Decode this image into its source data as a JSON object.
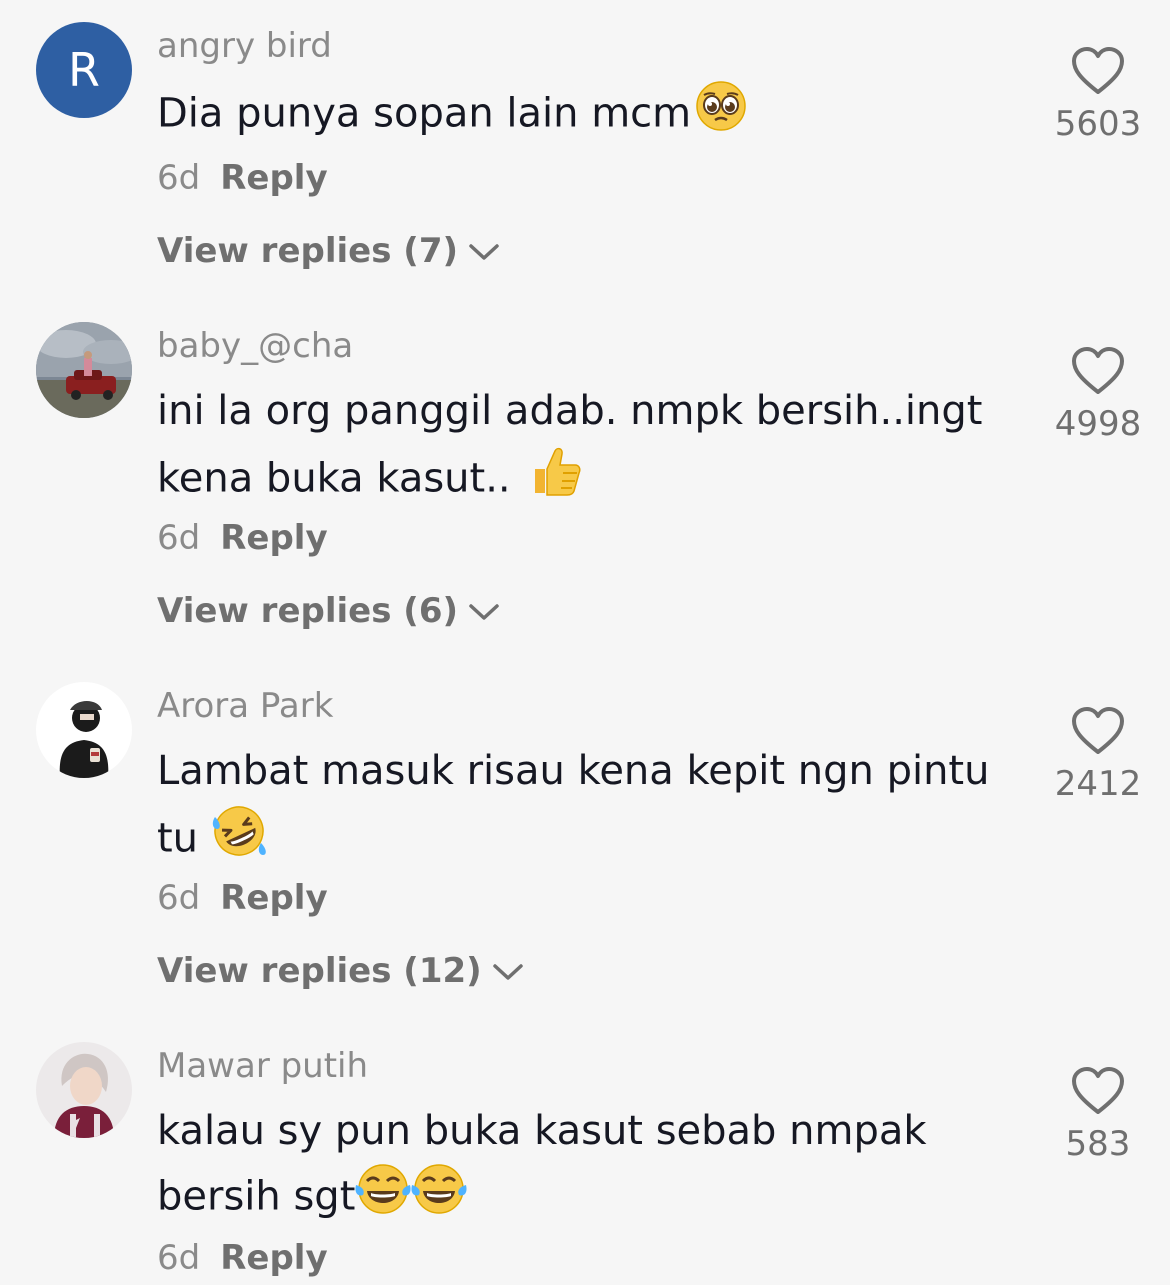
{
  "comments": [
    {
      "avatar_letter": "R",
      "username": "angry bird",
      "text": "Dia punya sopan lain mcm",
      "emoji": "pleading-face",
      "time": "6d",
      "reply_label": "Reply",
      "view_replies": "View replies (7)",
      "likes": "5603"
    },
    {
      "username": "baby_@cha",
      "text": "ini la org panggil adab. nmpk bersih..ingt kena buka kasut..",
      "emoji": "thumbs-up",
      "time": "6d",
      "reply_label": "Reply",
      "view_replies": "View replies (6)",
      "likes": "4998"
    },
    {
      "username": "Arora Park",
      "text": "Lambat masuk risau kena kepit ngn pintu tu",
      "emoji": "rolling-on-floor-laughing",
      "time": "6d",
      "reply_label": "Reply",
      "view_replies": "View replies (12)",
      "likes": "2412"
    },
    {
      "username": "Mawar putih",
      "text": "kalau sy pun buka kasut sebab nmpak bersih sgt",
      "emoji": "face-with-tears-of-joy x2",
      "time": "6d",
      "reply_label": "Reply",
      "likes": "583"
    }
  ],
  "colors": {
    "background": "#f6f6f6",
    "username": "#8a8a8a",
    "text": "#161823",
    "secondary": "#6f6f6f",
    "avatar_letter_bg": "#2e5fa3"
  }
}
